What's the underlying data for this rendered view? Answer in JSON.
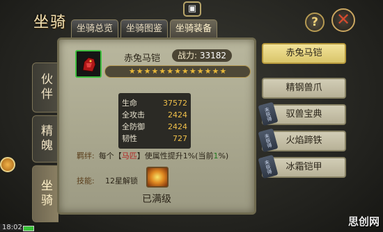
{
  "header": {
    "title": "坐骑",
    "tabs": [
      {
        "label": "坐骑总览"
      },
      {
        "label": "坐骑图鉴"
      },
      {
        "label": "坐骑装备"
      }
    ],
    "camera_icon": "camera-icon",
    "help_label": "?",
    "close_label": "✕"
  },
  "sidebar": {
    "items": [
      {
        "label": "伙伴"
      },
      {
        "label": "精魄"
      },
      {
        "label": "坐骑"
      }
    ]
  },
  "mount": {
    "name": "赤兔马铠",
    "power_label": "战力:",
    "power_value": "33182",
    "star_count": 13,
    "stats": [
      {
        "label": "生命",
        "value": "37572"
      },
      {
        "label": "全攻击",
        "value": "2424"
      },
      {
        "label": "全防御",
        "value": "2424"
      },
      {
        "label": "韧性",
        "value": "727"
      }
    ],
    "fetter": {
      "label": "羁绊:",
      "text_before": "每个【",
      "tag": "马匹",
      "text_mid": "】使属性提升1%(当前",
      "current": "1",
      "text_after": "%)"
    },
    "skill": {
      "label": "技能:",
      "text": "12星解锁"
    },
    "max_level_text": "已满级"
  },
  "equip_list": {
    "items": [
      {
        "label": "赤兔马铠",
        "selected": true,
        "tag": ""
      },
      {
        "label": "精钢兽爪",
        "selected": false,
        "tag": ""
      },
      {
        "label": "驭兽宝典",
        "selected": false,
        "tag": "未获得"
      },
      {
        "label": "火焰蹄铁",
        "selected": false,
        "tag": "未获得"
      },
      {
        "label": "冰霜铠甲",
        "selected": false,
        "tag": "未获得"
      }
    ]
  },
  "status_bar": {
    "time": "18:02"
  },
  "watermark": "思创网",
  "colors": {
    "accent_gold": "#f0c04a",
    "fetter_red": "#b22020",
    "fetter_green": "#1d7a1d",
    "selected_item": "#f2e39a"
  }
}
